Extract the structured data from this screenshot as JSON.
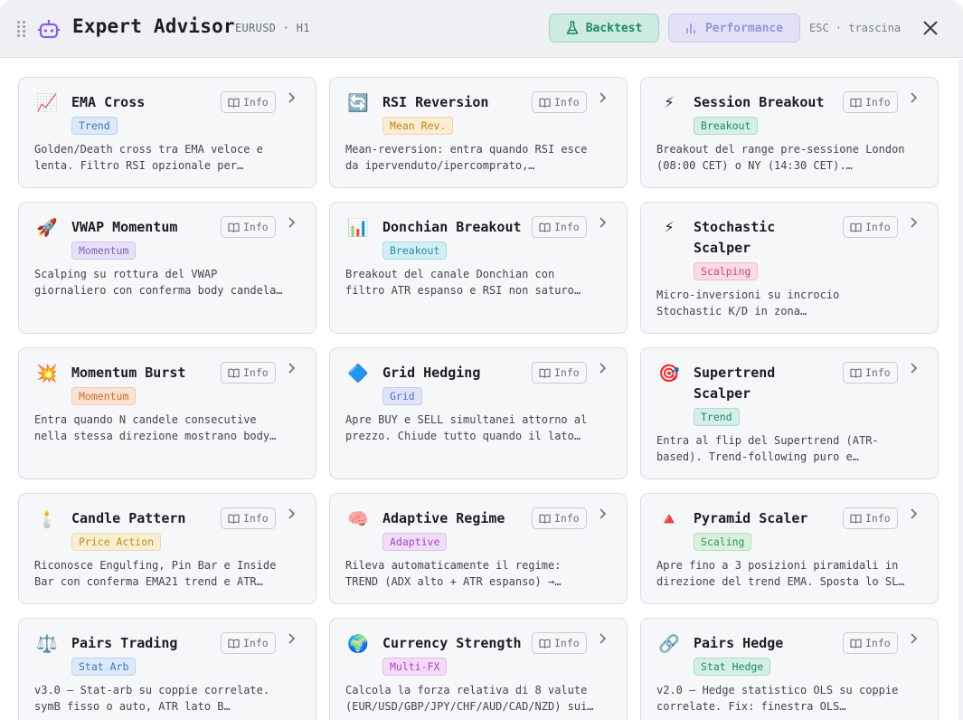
{
  "header": {
    "title": "Expert Advisor",
    "subtitle": "EURUSD · H1",
    "backtest_label": "Backtest",
    "performance_label": "Performance",
    "hint": "ESC · trascina",
    "accent_backtest": "#1b8a62",
    "accent_performance": "#9892df"
  },
  "strategies": [
    {
      "name": "EMA Cross",
      "icon": "📈",
      "badge": "Trend",
      "badge_color": "#3a78c6",
      "badge_bg": "#dce9f9",
      "info": "Info",
      "desc_l1": "Golden/Death cross tra EMA veloce e",
      "desc_l2": "lenta. Filtro RSI opzionale per…"
    },
    {
      "name": "RSI Reversion",
      "icon": "🔄",
      "badge": "Mean Rev.",
      "badge_color": "#c5831c",
      "badge_bg": "#fbecd4",
      "info": "Info",
      "desc_l1": "Mean-reversion: entra quando RSI esce",
      "desc_l2": "da ipervenduto/ipercomprato,…"
    },
    {
      "name": "Session Breakout",
      "icon": "⚡",
      "badge": "Breakout",
      "badge_color": "#1b8a62",
      "badge_bg": "#d5efe4",
      "info": "Info",
      "desc_l1": "Breakout del range pre-sessione London",
      "desc_l2": "(08:00 CET) o NY (14:30 CET).…"
    },
    {
      "name": "VWAP Momentum",
      "icon": "🚀",
      "badge": "Momentum",
      "badge_color": "#7a64c8",
      "badge_bg": "#e5e0f6",
      "info": "Info",
      "desc_l1": "Scalping su rottura del VWAP",
      "desc_l2": "giornaliero con conferma body candela…"
    },
    {
      "name": "Donchian Breakout",
      "icon": "📊",
      "badge": "Breakout",
      "badge_color": "#1f8fa8",
      "badge_bg": "#d3eef4",
      "info": "Info",
      "desc_l1": "Breakout del canale Donchian con",
      "desc_l2": "filtro ATR espanso e RSI non saturo…"
    },
    {
      "name_l1": "Stochastic",
      "name_l2": "Scalper",
      "icon": "⚡",
      "badge": "Scalping",
      "badge_color": "#d0467a",
      "badge_bg": "#fadbe6",
      "info": "Info",
      "desc_l1": "Micro-inversioni su incrocio",
      "desc_l2": "Stochastic K/D in zona…"
    },
    {
      "name": "Momentum Burst",
      "icon": "💥",
      "badge": "Momentum",
      "badge_color": "#d06a2a",
      "badge_bg": "#fbe3d3",
      "info": "Info",
      "desc_l1": "Entra quando N candele consecutive",
      "desc_l2": "nella stessa direzione mostrano body…"
    },
    {
      "name": "Grid Hedging",
      "icon": "🔷",
      "badge": "Grid",
      "badge_color": "#5a6cc8",
      "badge_bg": "#e0e4f8",
      "info": "Info",
      "desc_l1": "Apre BUY e SELL simultanei attorno al",
      "desc_l2": "prezzo. Chiude tutto quando il lato…"
    },
    {
      "name_l1": "Supertrend",
      "name_l2": "Scalper",
      "icon": "🎯",
      "badge": "Trend",
      "badge_color": "#1b8a72",
      "badge_bg": "#d5efe8",
      "info": "Info",
      "desc_l1": "Entra al flip del Supertrend (ATR-",
      "desc_l2": "based). Trend-following puro e…"
    },
    {
      "name": "Candle Pattern",
      "icon": "🕯️",
      "badge": "Price Action",
      "badge_color": "#b8901a",
      "badge_bg": "#f8efd2",
      "info": "Info",
      "desc_l1": "Riconosce Engulfing, Pin Bar e Inside",
      "desc_l2": "Bar con conferma EMA21 trend e ATR…"
    },
    {
      "name": "Adaptive Regime",
      "icon": "🧠",
      "badge": "Adaptive",
      "badge_color": "#a246c8",
      "badge_bg": "#f0def8",
      "info": "Info",
      "desc_l1": "Rileva automaticamente il regime:",
      "desc_l2": "TREND (ADX alto + ATR espanso) →…"
    },
    {
      "name": "Pyramid Scaler",
      "icon": "🔺",
      "badge": "Scaling",
      "badge_color": "#2a9a4a",
      "badge_bg": "#d8f0dd",
      "info": "Info",
      "desc_l1": "Apre fino a 3 posizioni piramidali in",
      "desc_l2": "direzione del trend EMA. Sposta lo SL…"
    },
    {
      "name": "Pairs Trading",
      "icon": "⚖️",
      "badge": "Stat Arb",
      "badge_color": "#3a78c6",
      "badge_bg": "#dce9f9",
      "info": "Info",
      "desc_l1": "v3.0 — Stat-arb su coppie correlate.",
      "desc_l2": "symB fisso o auto, ATR lato B…"
    },
    {
      "name": "Currency Strength",
      "icon": "🌍",
      "badge": "Multi-FX",
      "badge_color": "#b43ec8",
      "badge_bg": "#f3dcf7",
      "info": "Info",
      "desc_l1": "Calcola la forza relativa di 8 valute",
      "desc_l2": "(EUR/USD/GBP/JPY/CHF/AUD/CAD/NZD) sui…"
    },
    {
      "name": "Pairs Hedge",
      "icon": "🔗",
      "badge": "Stat Hedge",
      "badge_color": "#1b8a62",
      "badge_bg": "#d5efe4",
      "info": "Info",
      "desc_l1": "v2.0 — Hedge statistico OLS su coppie",
      "desc_l2": "correlate. Fix: finestra OLS…"
    }
  ]
}
